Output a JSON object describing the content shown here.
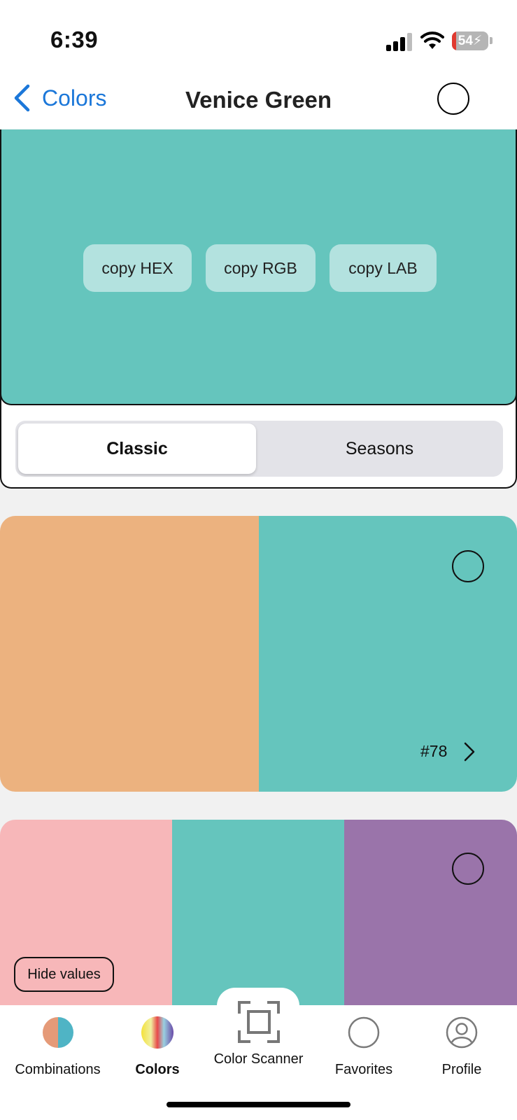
{
  "status_bar": {
    "time": "6:39",
    "battery_pct": "54",
    "signal_bars": 3
  },
  "nav": {
    "back_label": "Colors",
    "title": "Venice Green"
  },
  "hero": {
    "color": "#65c5bd",
    "copy_buttons": [
      "copy HEX",
      "copy RGB",
      "copy LAB"
    ]
  },
  "segmented": {
    "options": [
      "Classic",
      "Seasons"
    ],
    "selected": "Classic"
  },
  "combinations": [
    {
      "number": "#78",
      "colors": [
        "#ecb27f",
        "#65c5bd"
      ]
    },
    {
      "colors": [
        "#f7b7b9",
        "#65c5bd",
        "#9a74aa"
      ],
      "hide_values_label": "Hide values"
    }
  ],
  "tab_bar": {
    "items": [
      {
        "label": "Combinations",
        "icon": "combinations-icon"
      },
      {
        "label": "Colors",
        "icon": "colors-icon",
        "active": true
      },
      {
        "label": "Color Scanner",
        "icon": "scanner-icon"
      },
      {
        "label": "Favorites",
        "icon": "favorites-icon"
      },
      {
        "label": "Profile",
        "icon": "profile-icon"
      }
    ]
  }
}
